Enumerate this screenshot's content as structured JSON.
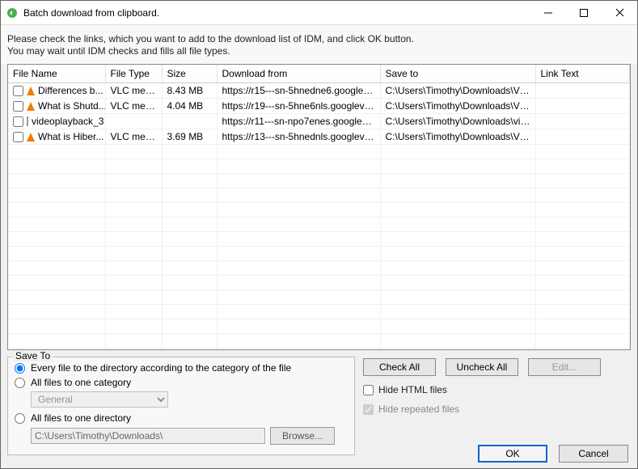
{
  "window": {
    "title": "Batch download from clipboard."
  },
  "instructions": {
    "line1": "Please check the links, which you want to add to the download list of IDM, and click OK button.",
    "line2": "You may wait until IDM checks and fills all file types."
  },
  "table": {
    "headers": {
      "file_name": "File Name",
      "file_type": "File Type",
      "size": "Size",
      "download_from": "Download from",
      "save_to": "Save to",
      "link_text": "Link Text"
    },
    "rows": [
      {
        "checked": false,
        "icon": "vlc",
        "file_name": "Differences b...",
        "file_type": "VLC medi...",
        "size": "8.43  MB",
        "download_from": "https://r15---sn-5hnedne6.googlevi...",
        "save_to": "C:\\Users\\Timothy\\Downloads\\Video\\...",
        "link_text": ""
      },
      {
        "checked": false,
        "icon": "vlc",
        "file_name": "What is Shutd...",
        "file_type": "VLC medi...",
        "size": "4.04  MB",
        "download_from": "https://r19---sn-5hne6nls.googlevid...",
        "save_to": "C:\\Users\\Timothy\\Downloads\\Video\\...",
        "link_text": ""
      },
      {
        "checked": false,
        "icon": "file",
        "file_name": "videoplayback_3",
        "file_type": "",
        "size": "",
        "download_from": "https://r11---sn-npo7enes.googlevi...",
        "save_to": "C:\\Users\\Timothy\\Downloads\\videop...",
        "link_text": ""
      },
      {
        "checked": false,
        "icon": "vlc",
        "file_name": "What is Hiber...",
        "file_type": "VLC medi...",
        "size": "3.69  MB",
        "download_from": "https://r13---sn-5hnednls.googlevid...",
        "save_to": "C:\\Users\\Timothy\\Downloads\\Video\\...",
        "link_text": ""
      }
    ]
  },
  "save_to": {
    "group_title": "Save To",
    "opt_category": "Every file to the directory according to the category of the file",
    "opt_one_category": "All files to one category",
    "category_value": "General",
    "opt_one_directory": "All files to one directory",
    "directory_value": "C:\\Users\\Timothy\\Downloads\\",
    "browse_label": "Browse..."
  },
  "buttons": {
    "check_all": "Check All",
    "uncheck_all": "Uncheck All",
    "edit": "Edit...",
    "ok": "OK",
    "cancel": "Cancel"
  },
  "options": {
    "hide_html": "Hide HTML files",
    "hide_repeated": "Hide repeated files"
  }
}
